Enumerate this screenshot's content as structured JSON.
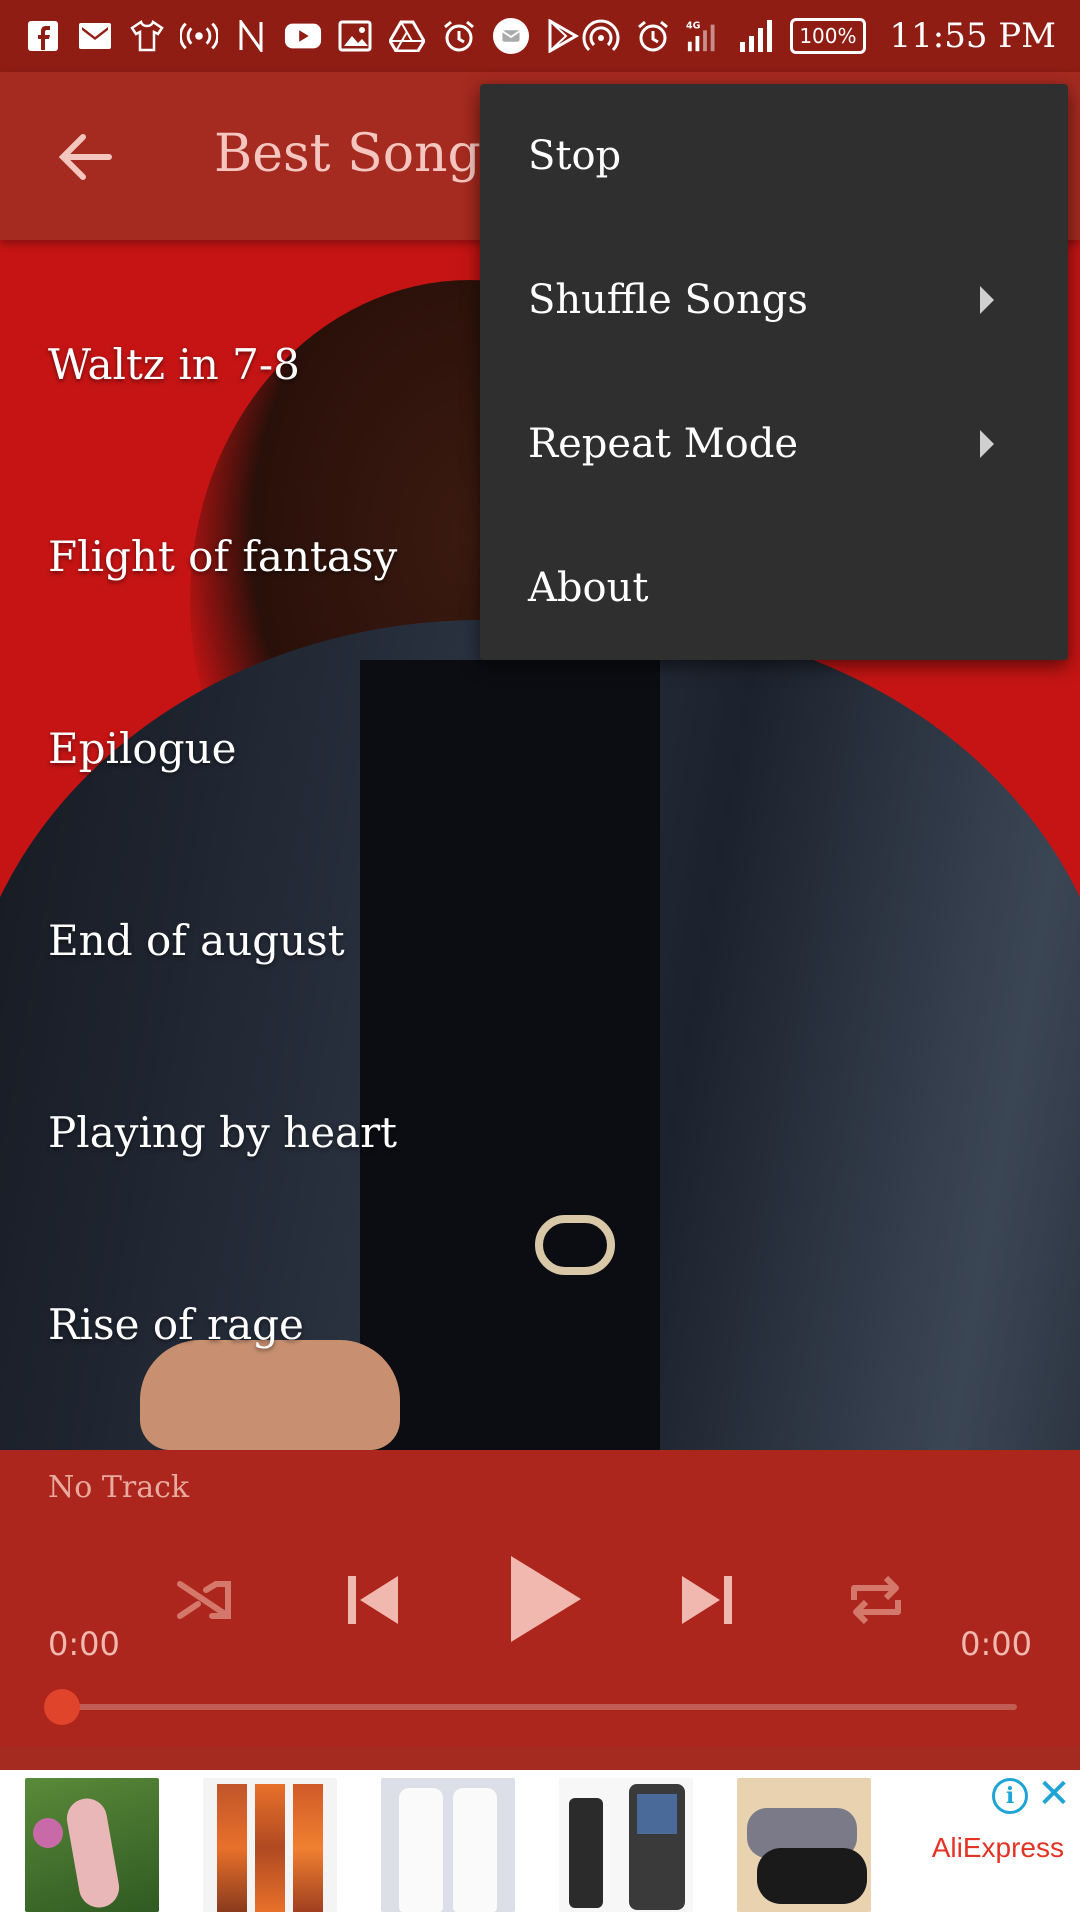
{
  "status_bar": {
    "time": "11:55 PM",
    "battery": "100%",
    "icons": [
      "facebook-icon",
      "gmail-icon",
      "shirt-icon",
      "broadcast-icon",
      "n-icon",
      "youtube-icon",
      "gallery-icon",
      "drive-icon",
      "alarm-icon",
      "mail-bubble-icon",
      "play-store-icon",
      "hotspot-icon",
      "alarm-icon",
      "signal-4g-icon",
      "signal-icon",
      "battery-icon"
    ]
  },
  "app_bar": {
    "title": "Best Songs",
    "back_icon": "arrow-back-icon"
  },
  "songs": [
    {
      "title": "Waltz in 7-8"
    },
    {
      "title": "Flight of fantasy"
    },
    {
      "title": "Epilogue"
    },
    {
      "title": "End of august"
    },
    {
      "title": "Playing by heart"
    },
    {
      "title": "Rise of rage"
    }
  ],
  "player": {
    "track": "No Track",
    "elapsed": "0:00",
    "duration": "0:00",
    "progress": 0,
    "controls": [
      "shuffle-icon",
      "skip-previous-icon",
      "play-icon",
      "skip-next-icon",
      "repeat-icon"
    ]
  },
  "menu": {
    "items": [
      {
        "label": "Stop",
        "has_submenu": false
      },
      {
        "label": "Shuffle Songs",
        "has_submenu": true
      },
      {
        "label": "Repeat Mode",
        "has_submenu": true
      },
      {
        "label": "About",
        "has_submenu": false
      }
    ]
  },
  "ad": {
    "brand": "AliExpress",
    "info_label": "i",
    "close_label": "✕"
  },
  "colors": {
    "status_bar": "#8f1d14",
    "app_bar": "#a52a1f",
    "background": "#c61414",
    "menu": "#2f2f2f",
    "seek_thumb": "#e0442a",
    "ad_accent": "#1ea5d6",
    "ad_brand": "#e43225"
  }
}
